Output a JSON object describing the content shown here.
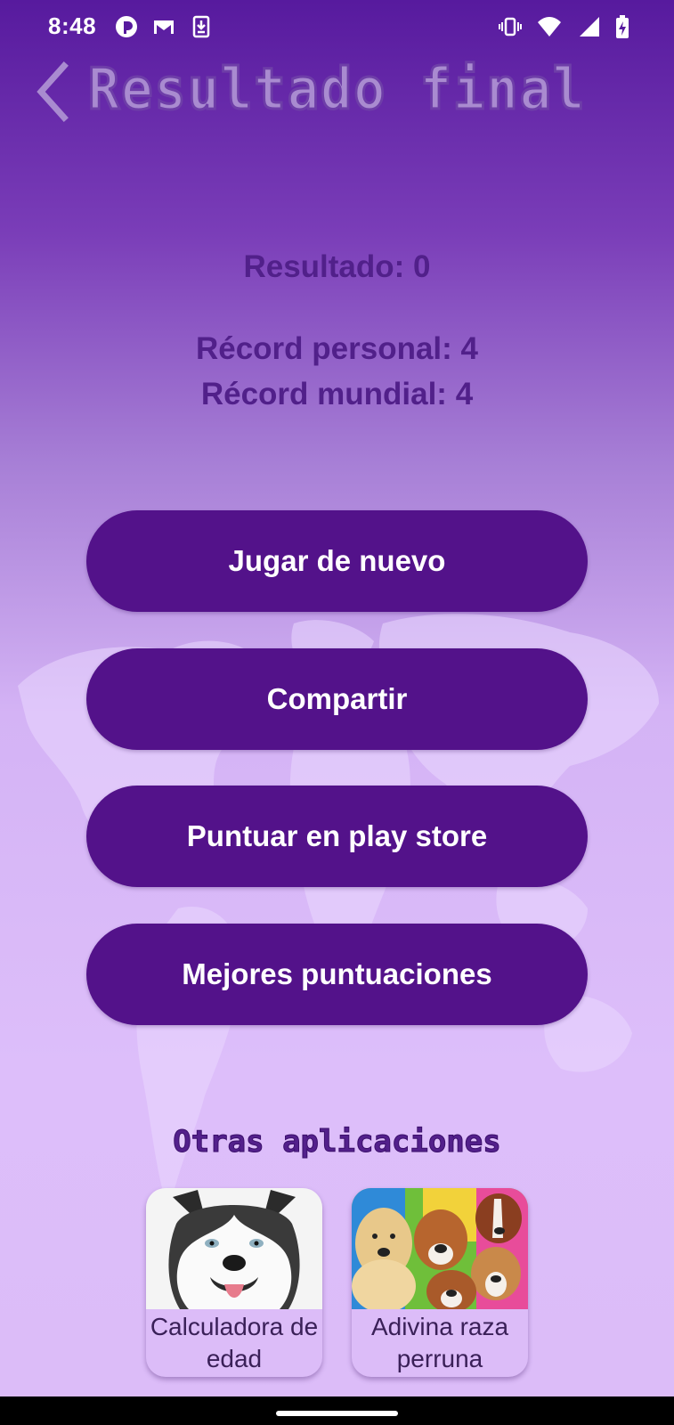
{
  "status_bar": {
    "time": "8:48",
    "left_icons": [
      "app-notification-icon",
      "gmail-icon",
      "download-icon"
    ],
    "right_icons": [
      "vibrate-icon",
      "wifi-icon",
      "signal-icon",
      "battery-charging-icon"
    ]
  },
  "header": {
    "back_icon": "chevron-left-icon",
    "title": "Resultado final"
  },
  "scores": {
    "current": "Resultado: 0",
    "personal_record": "Récord personal: 4",
    "world_record": "Récord mundial: 4"
  },
  "buttons": {
    "play_again": "Jugar de nuevo",
    "share": "Compartir",
    "rate": "Puntuar en play store",
    "leaderboard": "Mejores puntuaciones"
  },
  "other_apps": {
    "title": "Otras aplicaciones",
    "apps": [
      {
        "label": "Calculadora de edad",
        "image": "husky-dog-image"
      },
      {
        "label": "Adivina raza perruna",
        "image": "dog-breeds-collage-image"
      }
    ]
  },
  "colors": {
    "accent": "#53128a",
    "text_primary": "#51208a",
    "background_top": "#571a9e",
    "background_bottom": "#dcbcf8"
  }
}
